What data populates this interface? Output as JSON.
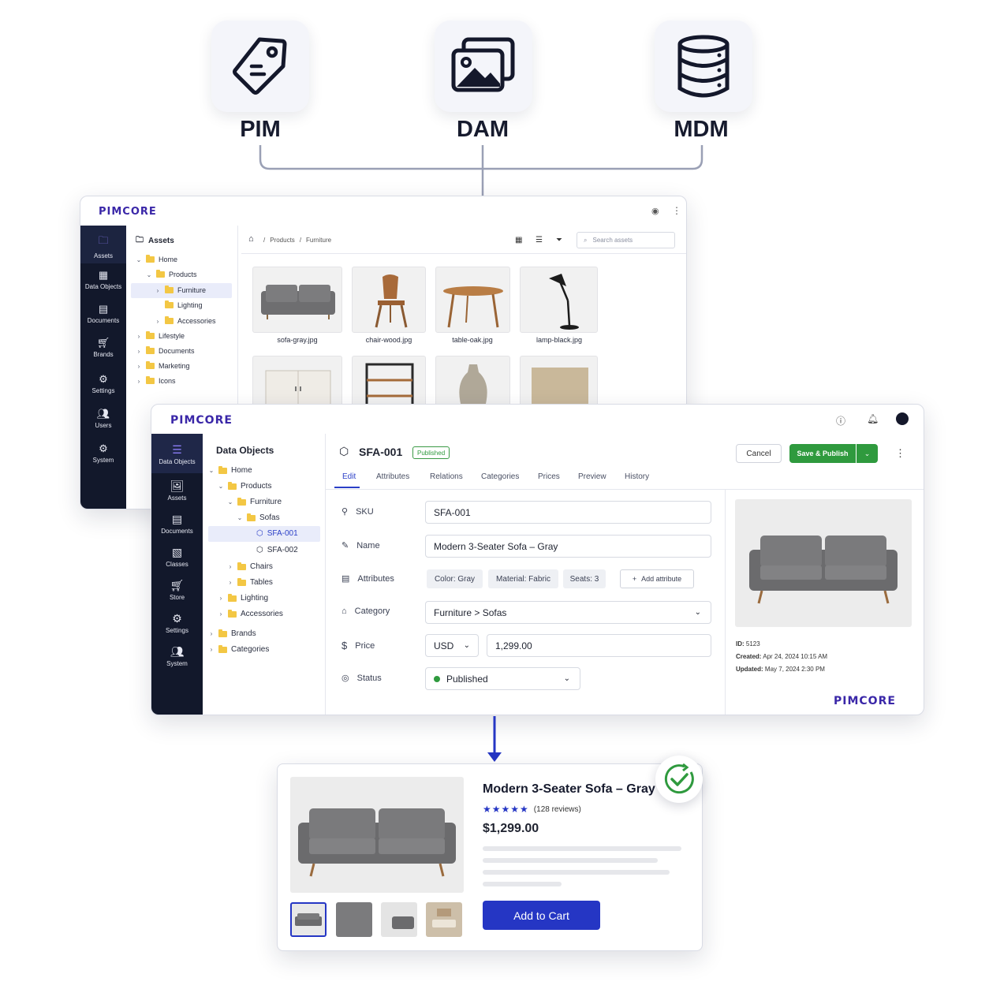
{
  "top_tiles": {
    "pim": {
      "label": "PIM",
      "icon": "tag-icon"
    },
    "dam": {
      "label": "DAM",
      "icon": "images-icon"
    },
    "mdm": {
      "label": "MDM",
      "icon": "database-icon"
    }
  },
  "assets_window": {
    "logo": "PIMCORE",
    "sidebar": [
      {
        "label": "Assets",
        "icon": "assets-icon"
      },
      {
        "label": "Data Objects",
        "icon": "data-objects-icon"
      },
      {
        "label": "Documents",
        "icon": "documents-icon"
      },
      {
        "label": "Brands",
        "icon": "cart-icon"
      },
      {
        "label": "Settings",
        "icon": "gear-icon"
      },
      {
        "label": "Users",
        "icon": "users-icon"
      },
      {
        "label": "System",
        "icon": "gear-icon"
      }
    ],
    "tree_title": "Assets",
    "tree": [
      {
        "label": "Home"
      },
      {
        "label": "Products"
      },
      {
        "label": "Furniture"
      },
      {
        "label": "Lighting"
      },
      {
        "label": "Accessories"
      },
      {
        "label": "Lifestyle"
      },
      {
        "label": "Documents"
      },
      {
        "label": "Marketing"
      },
      {
        "label": "Icons"
      }
    ],
    "breadcrumb": {
      "sep": "/",
      "products": "Products",
      "furniture": "Furniture"
    },
    "search_placeholder": "Search assets",
    "thumbnails": [
      {
        "name": "sofa-gray.jpg"
      },
      {
        "name": "chair-wood.jpg"
      },
      {
        "name": "table-oak.jpg"
      },
      {
        "name": "lamp-black.jpg"
      }
    ]
  },
  "objects_window": {
    "logo": "PIMCORE",
    "sidebar": [
      {
        "label": "Data Objects"
      },
      {
        "label": "Assets"
      },
      {
        "label": "Documents"
      },
      {
        "label": "Classes"
      },
      {
        "label": "Store"
      },
      {
        "label": "Settings"
      },
      {
        "label": "System"
      }
    ],
    "tree_title": "Data Objects",
    "tree": [
      {
        "label": "Home"
      },
      {
        "label": "Products"
      },
      {
        "label": "Furniture"
      },
      {
        "label": "Sofas"
      },
      {
        "label": "SFA-001"
      },
      {
        "label": "SFA-002"
      },
      {
        "label": "Chairs"
      },
      {
        "label": "Tables"
      },
      {
        "label": "Lighting"
      },
      {
        "label": "Accessories"
      },
      {
        "label": "Brands"
      },
      {
        "label": "Categories"
      }
    ],
    "object_id": "SFA-001",
    "status_badge": "Published",
    "cancel_label": "Cancel",
    "save_label": "Save & Publish",
    "tabs": [
      "Edit",
      "Attributes",
      "Relations",
      "Categories",
      "Prices",
      "Preview",
      "History"
    ],
    "fields": {
      "sku_label": "SKU",
      "sku_value": "SFA-001",
      "name_label": "Name",
      "name_value": "Modern 3-Seater Sofa – Gray",
      "attributes_label": "Attributes",
      "chips": [
        "Color: Gray",
        "Material: Fabric",
        "Seats: 3"
      ],
      "add_attribute": "Add attribute",
      "category_label": "Category",
      "category_value": "Furniture > Sofas",
      "price_label": "Price",
      "currency": "USD",
      "price_value": "1,299.00",
      "status_label": "Status",
      "status_value": "Published"
    },
    "meta": {
      "id_label": "ID:",
      "id_value": "5123",
      "created_label": "Created:",
      "created_value": "Apr 24, 2024 10:15 AM",
      "updated_label": "Updated:",
      "updated_value": "May 7, 2024 2:30 PM"
    },
    "footer_logo": "PIMCORE"
  },
  "product_card": {
    "title": "Modern 3-Seater Sofa – Gray",
    "rating_stars": 5,
    "reviews": "(128 reviews)",
    "price": "$1,299.00",
    "cta": "Add to Cart"
  },
  "colors": {
    "accent_blue": "#2536c4",
    "green": "#2f9a3e",
    "sidebar_dark": "#12182b",
    "logo_purple": "#3a27a8"
  }
}
